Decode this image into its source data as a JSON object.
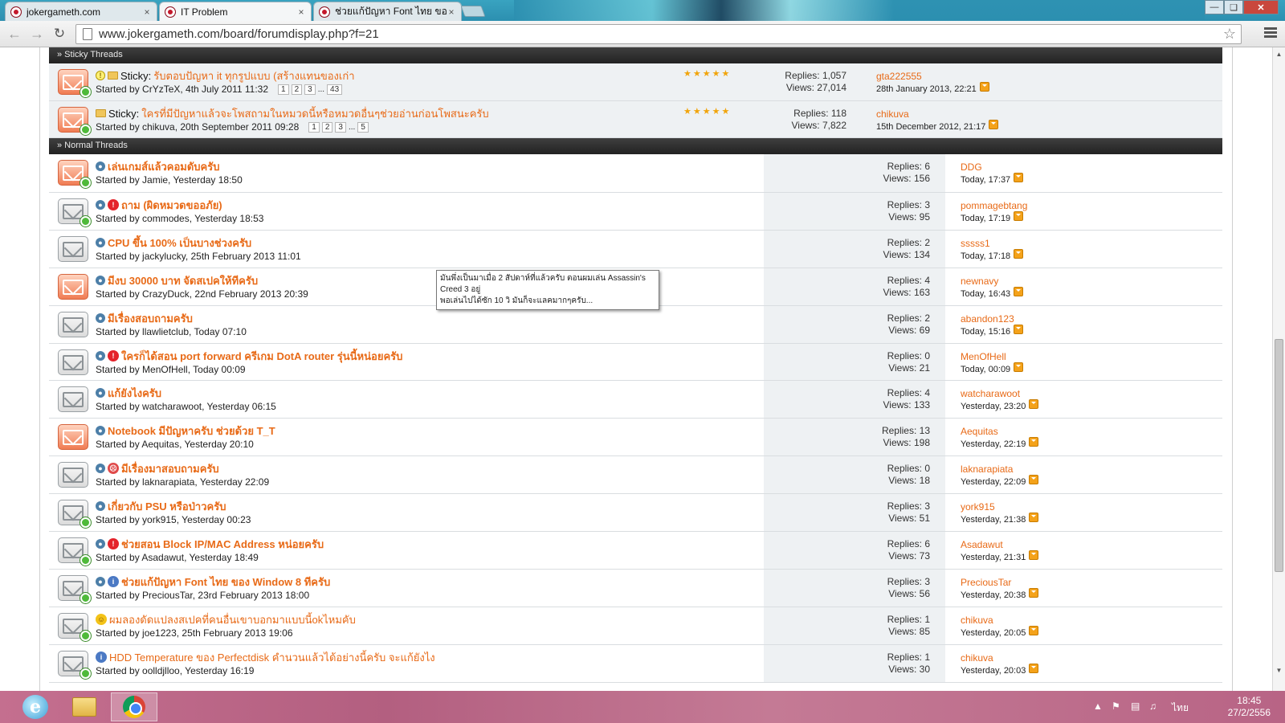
{
  "browser": {
    "tabs": [
      {
        "title": "jokergameth.com",
        "close": "×"
      },
      {
        "title": "IT Problem",
        "close": "×"
      },
      {
        "title": "ช่วยแก้ปัญหา Font ไทย ของ W",
        "close": "×"
      }
    ],
    "url": "www.jokergameth.com/board/forumdisplay.php?f=21",
    "icons": {
      "back": "back-arrow-icon",
      "forward": "forward-arrow-icon",
      "reload": "reload-icon",
      "star": "bookmark-star-icon",
      "menu": "wrench-menu-icon"
    }
  },
  "sections": {
    "sticky": "» Sticky Threads",
    "normal": "» Normal Threads"
  },
  "sticky_threads": [
    {
      "prefix": "Sticky:",
      "title": "รับตอบปัญหา it ทุกรูปแบบ (สร้างแทนของเก่า",
      "starter": "Started by CrYzTeX, 4th July 2011 11:32",
      "pages": [
        "1",
        "2",
        "3"
      ],
      "dots": "...",
      "last_page": "43",
      "rating": "★★★★★",
      "replies": "Replies: 1,057",
      "views": "Views: 27,014",
      "last_user": "gta222555",
      "last_date": "28th January 2013, 22:21"
    },
    {
      "prefix": "Sticky:",
      "title": "ใครที่มีปัญหาแล้วจะโพสถามในหมวดนี้หรือหมวดอื่นๆช่วยอ่านก่อนโพสนะครับ",
      "starter": "Started by chikuva, 20th September 2011 09:28",
      "pages": [
        "1",
        "2",
        "3"
      ],
      "dots": "...",
      "last_page": "5",
      "rating": "★★★★★",
      "replies": "Replies: 118",
      "views": "Views: 7,822",
      "last_user": "chikuva",
      "last_date": "15th December 2012, 21:17"
    }
  ],
  "threads": [
    {
      "title": "เล่นเกมส์แล้วคอมดับครับ",
      "starter": "Started by Jamie, Yesterday 18:50",
      "replies": "Replies: 6",
      "views": "Views: 156",
      "last_user": "DDG",
      "last_date": "Today, 17:37"
    },
    {
      "title": "ถาม (ผิดหมวดขออภัย)",
      "starter": "Started by commodes, Yesterday 18:53",
      "replies": "Replies: 3",
      "views": "Views: 95",
      "last_user": "pommagebtang",
      "last_date": "Today, 17:19"
    },
    {
      "title": "CPU ขึ้น 100% เป็นบางช่วงครับ",
      "starter": "Started by jackylucky, 25th February 2013 11:01",
      "replies": "Replies: 2",
      "views": "Views: 134",
      "last_user": "sssss1",
      "last_date": "Today, 17:18"
    },
    {
      "title": "มีงบ 30000 บาท จัดสเปคให้ทีครับ",
      "starter": "Started by CrazyDuck, 22nd February 2013 20:39",
      "replies": "Replies: 4",
      "views": "Views: 163",
      "last_user": "newnavy",
      "last_date": "Today, 16:43"
    },
    {
      "title": "มีเรื่องสอบถามครับ",
      "starter": "Started by llawlietclub, Today 07:10",
      "replies": "Replies: 2",
      "views": "Views: 69",
      "last_user": "abandon123",
      "last_date": "Today, 15:16"
    },
    {
      "title": "ใครก็ได้สอน port forward ครีเกม DotA router รุ่นนี้หน่อยครับ",
      "starter": "Started by MenOfHell, Today 00:09",
      "replies": "Replies: 0",
      "views": "Views: 21",
      "last_user": "MenOfHell",
      "last_date": "Today, 00:09"
    },
    {
      "title": "แก้ยังไงครับ",
      "starter": "Started by watcharawoot, Yesterday 06:15",
      "replies": "Replies: 4",
      "views": "Views: 133",
      "last_user": "watcharawoot",
      "last_date": "Yesterday, 23:20"
    },
    {
      "title": "Notebook มีปัญหาครับ ช่วยด้วย T_T",
      "starter": "Started by Aequitas, Yesterday 20:10",
      "replies": "Replies: 13",
      "views": "Views: 198",
      "last_user": "Aequitas",
      "last_date": "Yesterday, 22:19"
    },
    {
      "title": "มีเรื่องมาสอบถามครับ",
      "starter": "Started by laknarapiata, Yesterday 22:09",
      "replies": "Replies: 0",
      "views": "Views: 18",
      "last_user": "laknarapiata",
      "last_date": "Yesterday, 22:09"
    },
    {
      "title": "เกี่ยวกับ PSU หรือป่าวครับ",
      "starter": "Started by york915, Yesterday 00:23",
      "replies": "Replies: 3",
      "views": "Views: 51",
      "last_user": "york915",
      "last_date": "Yesterday, 21:38"
    },
    {
      "title": "ช่วยสอน Block IP/MAC Address หน่อยครับ",
      "starter": "Started by Asadawut, Yesterday 18:49",
      "replies": "Replies: 6",
      "views": "Views: 73",
      "last_user": "Asadawut",
      "last_date": "Yesterday, 21:31"
    },
    {
      "title": "ช่วยแก้ปัญหา Font ไทย ของ Window 8 ทีครับ",
      "starter": "Started by PreciousTar, 23rd February 2013 18:00",
      "replies": "Replies: 3",
      "views": "Views: 56",
      "last_user": "PreciousTar",
      "last_date": "Yesterday, 20:38"
    },
    {
      "title": "ผมลองดัดแปลงสเปคที่คนอื่นเขาบอกมาแบบนี้okไหมคับ",
      "starter": "Started by joe1223, 25th February 2013 19:06",
      "replies": "Replies: 1",
      "views": "Views: 85",
      "last_user": "chikuva",
      "last_date": "Yesterday, 20:05"
    },
    {
      "title": "HDD Temperature ของ Perfectdisk คำนวนแล้วได้อย่างนี้ครับ จะแก้ยังไง",
      "starter": "Started by oolldjlloo, Yesterday 16:19",
      "replies": "Replies: 1",
      "views": "Views: 30",
      "last_user": "chikuva",
      "last_date": "Yesterday, 20:03"
    }
  ],
  "tooltip": {
    "line1": "มันพึ่งเป็นมาเมื่อ 2 สัปดาห์ที่แล้วครับ ตอนผมเล่น Assassin's",
    "line2": "Creed 3 อยู่",
    "line3": "พอเล่นไปได้ซัก 10 วิ มันก็จะแลคมากๆครับ..."
  },
  "taskbar": {
    "lang": "ไทย",
    "time": "18:45",
    "date": "27/2/2556",
    "tray_up": "▲"
  },
  "colors": {
    "accent": "#e86a17",
    "header": "#2b2b2b",
    "tab_bar": "#2c8fb0",
    "taskbar": "#c46f8f"
  }
}
